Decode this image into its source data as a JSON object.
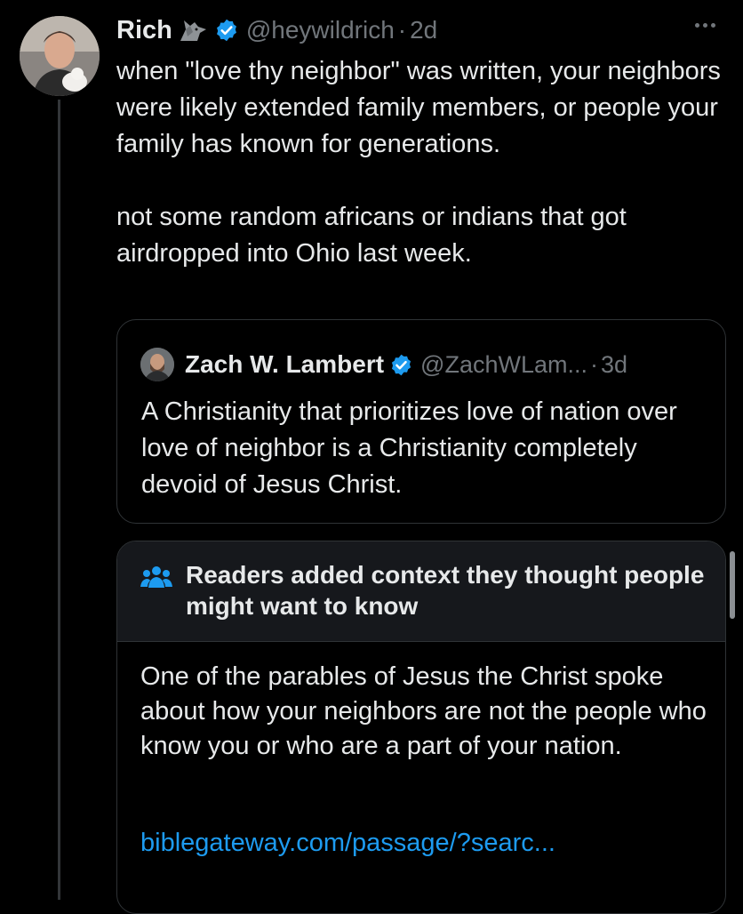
{
  "tweet": {
    "author_name": "Rich",
    "handle": "@heywildrich",
    "time": "2d",
    "text": "when \"love thy neighbor\" was written, your neighbors were likely extended family members, or people your family has known for generations.\n\nnot some random africans or indians that got airdropped into Ohio last week."
  },
  "quote": {
    "author_name": "Zach W. Lambert",
    "handle": "@ZachWLam...",
    "time": "3d",
    "text": "A Christianity that prioritizes love of nation over love of neighbor is a Christianity completely devoid of Jesus Christ."
  },
  "community_note": {
    "title": "Readers added context they thought people might want to know",
    "text": "One of the parables of Jesus the Christ spoke about how your neighbors are not the people who know you or who are a part of your nation.",
    "link": "biblegateway.com/passage/?searc..."
  },
  "icons": {
    "verified": "verified-badge-icon",
    "wolf": "wolf-emoji-icon",
    "more": "more-options-icon",
    "people": "people-icon"
  },
  "colors": {
    "background": "#000000",
    "text": "#e7e9ea",
    "secondary": "#71767b",
    "accent": "#1d9bf0",
    "border": "#2f3336"
  }
}
